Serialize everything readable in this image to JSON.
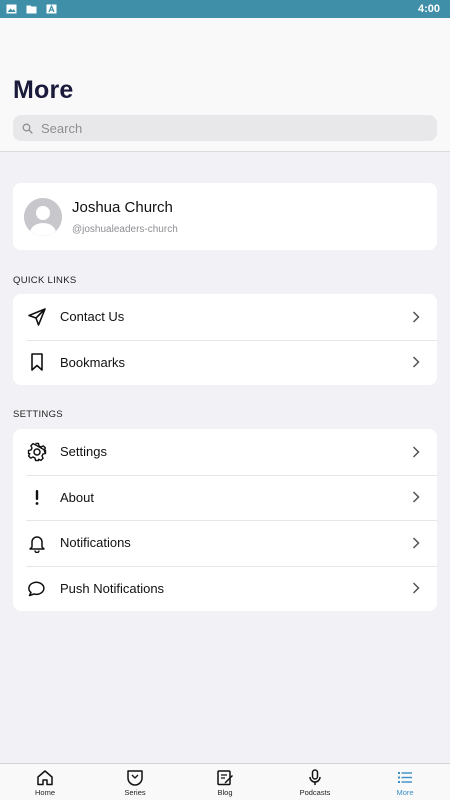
{
  "status_bar": {
    "time": "4:00",
    "icons": [
      "image-icon",
      "folder-icon",
      "text-a-icon"
    ]
  },
  "header": {
    "title": "More",
    "search": {
      "placeholder": "Search",
      "value": ""
    }
  },
  "profile": {
    "name": "Joshua Church",
    "handle": "@joshualeaders-church"
  },
  "quick_links": {
    "heading": "QUICK LINKS",
    "items": [
      {
        "label": "Contact Us",
        "icon": "send-icon"
      },
      {
        "label": "Bookmarks",
        "icon": "bookmark-icon"
      }
    ]
  },
  "settings": {
    "heading": "SETTINGS",
    "items": [
      {
        "label": "Settings",
        "icon": "gear-icon"
      },
      {
        "label": "About",
        "icon": "exclamation-icon"
      },
      {
        "label": "Notifications",
        "icon": "bell-icon"
      },
      {
        "label": "Push Notifications",
        "icon": "speech-bubble-icon"
      }
    ]
  },
  "tab_bar": {
    "active_color": "#3b8fc4",
    "tabs": [
      {
        "label": "Home",
        "icon": "home-icon"
      },
      {
        "label": "Series",
        "icon": "series-icon"
      },
      {
        "label": "Blog",
        "icon": "blog-icon"
      },
      {
        "label": "Podcasts",
        "icon": "microphone-icon"
      },
      {
        "label": "More",
        "icon": "list-icon",
        "active": true
      }
    ]
  }
}
